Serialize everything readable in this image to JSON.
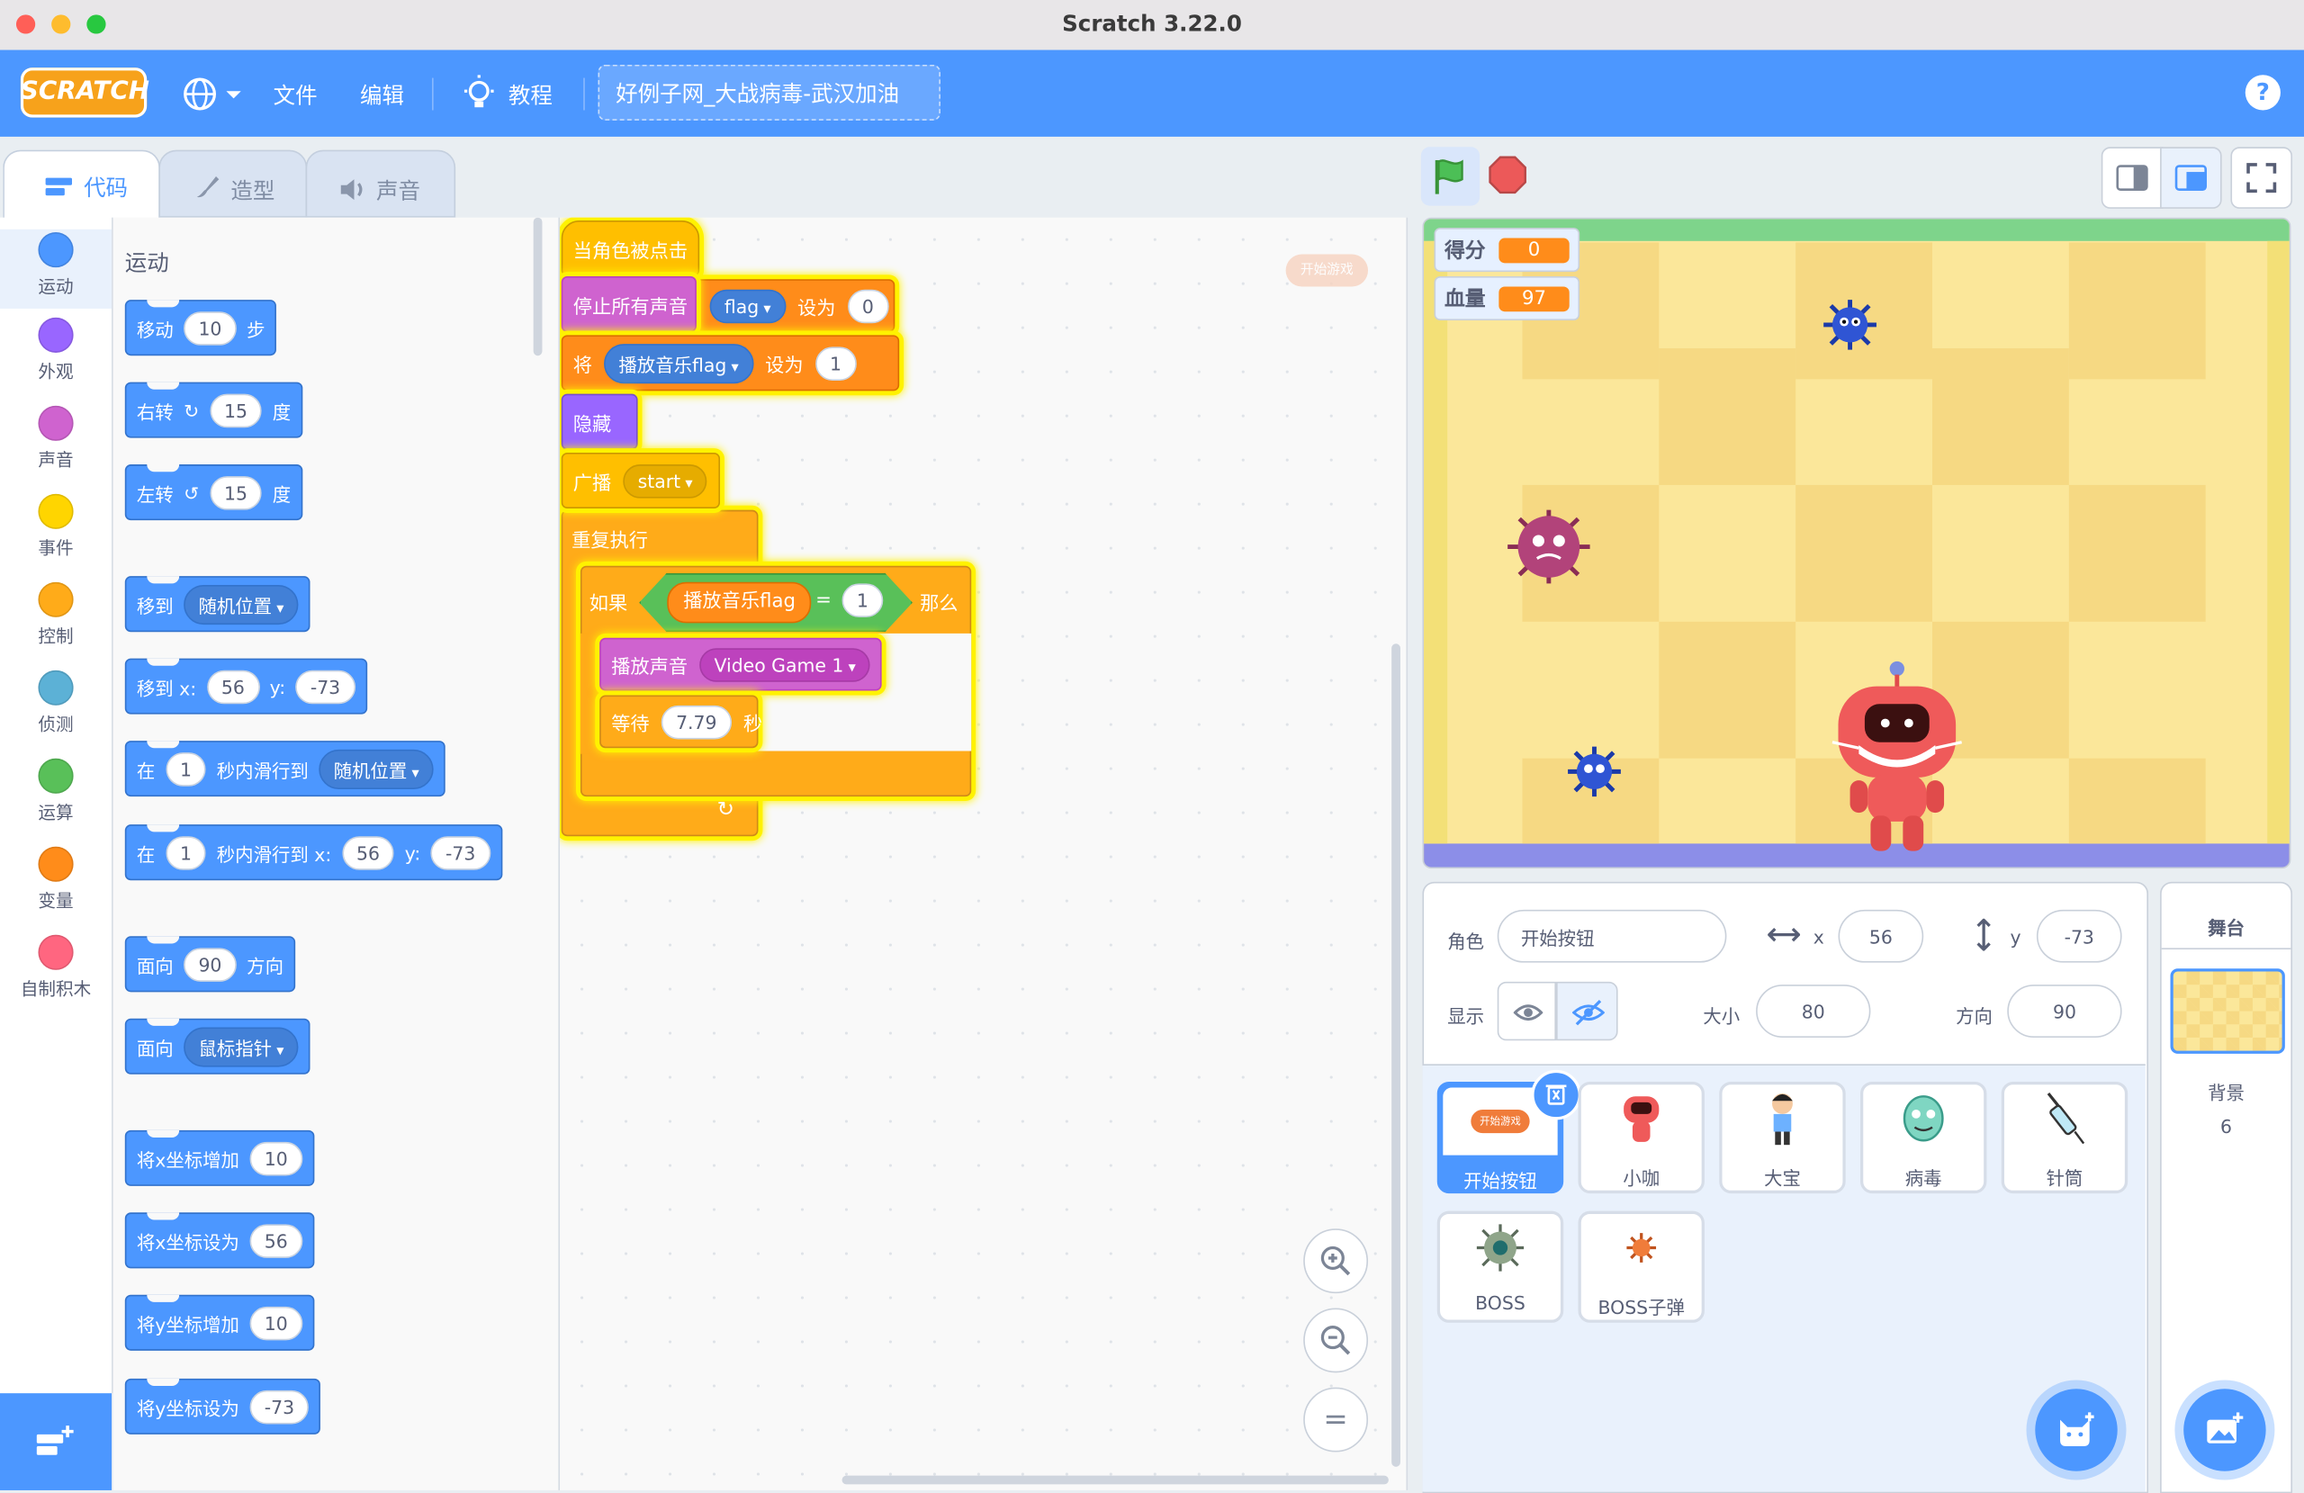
{
  "window": {
    "title": "Scratch 3.22.0"
  },
  "menubar": {
    "logo": "SCRATCH",
    "file": "文件",
    "edit": "编辑",
    "tutorials": "教程",
    "project_title": "好例子网_大战病毒-武汉加油",
    "help": "?"
  },
  "tabs": {
    "code": "代码",
    "costumes": "造型",
    "sounds": "声音"
  },
  "categories": [
    {
      "label": "运动",
      "color": "#4c97ff"
    },
    {
      "label": "外观",
      "color": "#9966ff"
    },
    {
      "label": "声音",
      "color": "#cf63cf"
    },
    {
      "label": "事件",
      "color": "#ffd500"
    },
    {
      "label": "控制",
      "color": "#ffab19"
    },
    {
      "label": "侦测",
      "color": "#5cb1d6"
    },
    {
      "label": "运算",
      "color": "#59c059"
    },
    {
      "label": "变量",
      "color": "#ff8c1a"
    },
    {
      "label": "自制积木",
      "color": "#ff6680"
    }
  ],
  "palette": {
    "heading": "运动",
    "move": {
      "a": "移动",
      "v": "10",
      "b": "步"
    },
    "turn_right": {
      "a": "右转",
      "v": "15",
      "b": "度"
    },
    "turn_left": {
      "a": "左转",
      "v": "15",
      "b": "度"
    },
    "goto": {
      "a": "移到",
      "dd": "随机位置"
    },
    "goto_xy": {
      "a": "移到 x:",
      "x": "56",
      "b": "y:",
      "y": "-73"
    },
    "glide": {
      "a": "在",
      "v": "1",
      "b": "秒内滑行到",
      "dd": "随机位置"
    },
    "glide_xy": {
      "a": "在",
      "v": "1",
      "b": "秒内滑行到 x:",
      "x": "56",
      "c": "y:",
      "y": "-73"
    },
    "point_dir": {
      "a": "面向",
      "v": "90",
      "b": "方向"
    },
    "point_towards": {
      "a": "面向",
      "dd": "鼠标指针"
    },
    "change_x": {
      "a": "将x坐标增加",
      "v": "10"
    },
    "set_x": {
      "a": "将x坐标设为",
      "v": "56"
    },
    "change_y": {
      "a": "将y坐标增加",
      "v": "10"
    },
    "set_y": {
      "a": "将y坐标设为",
      "v": "-73"
    }
  },
  "script": {
    "hat": "当角色被点击",
    "stop_sounds": "停止所有声音",
    "set1": {
      "dd": "flag",
      "b": "设为",
      "v": "0"
    },
    "set2": {
      "a": "将",
      "dd": "播放音乐flag",
      "b": "设为",
      "v": "1"
    },
    "hide": "隐藏",
    "broadcast": {
      "a": "广播",
      "dd": "start"
    },
    "forever": "重复执行",
    "if": {
      "a": "如果",
      "var": "播放音乐flag",
      "op": "=",
      "v": "1",
      "b": "那么"
    },
    "play": {
      "a": "播放声音",
      "dd": "Video Game 1"
    },
    "wait": {
      "a": "等待",
      "v": "7.79",
      "b": "秒"
    },
    "sprite_preview": "开始游戏"
  },
  "zoom": {
    "in": "+",
    "out": "−",
    "reset": "="
  },
  "monitors": [
    {
      "label": "得分",
      "value": "0"
    },
    {
      "label": "血量",
      "value": "97"
    }
  ],
  "sprite_info": {
    "sprite_label": "角色",
    "sprite_name": "开始按钮",
    "x_label": "x",
    "x": "56",
    "y_label": "y",
    "y": "-73",
    "show_label": "显示",
    "size_label": "大小",
    "size": "80",
    "direction_label": "方向",
    "direction": "90"
  },
  "sprites": [
    {
      "name": "开始按钮",
      "thumb": "开始游戏"
    },
    {
      "name": "小咖"
    },
    {
      "name": "大宝"
    },
    {
      "name": "病毒"
    },
    {
      "name": "针筒"
    },
    {
      "name": "BOSS"
    },
    {
      "name": "BOSS子弹"
    }
  ],
  "stage_panel": {
    "title": "舞台",
    "backdrops_label": "背景",
    "backdrops_count": "6"
  }
}
